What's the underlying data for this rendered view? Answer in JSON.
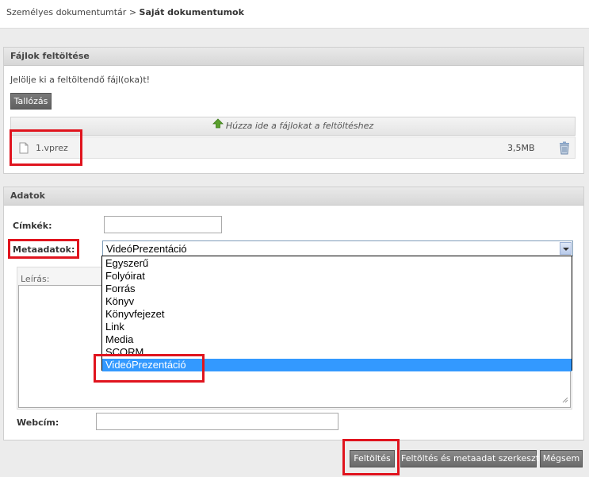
{
  "breadcrumb": {
    "parent": "Személyes dokumentumtár",
    "separator": ">",
    "current": "Saját dokumentumok"
  },
  "upload": {
    "header": "Fájlok feltöltése",
    "instruction": "Jelölje ki a feltöltendő fájl(oka)t!",
    "browse_label": "Tallózás",
    "dropzone_text": "Húzza ide a fájlokat a feltöltéshez",
    "file": {
      "name": "1.vprez",
      "size": "3,5MB"
    }
  },
  "data": {
    "header": "Adatok",
    "tags_label": "Címkék:",
    "tags_value": "",
    "metadata_label": "Metaadatok:",
    "metadata_selected": "VideóPrezentáció",
    "metadata_options": [
      "Egyszerű",
      "Folyóirat",
      "Forrás",
      "Könyv",
      "Könyvfejezet",
      "Link",
      "Media",
      "SCORM",
      "VideóPrezentáció"
    ],
    "description_label": "Leírás:",
    "url_label": "Webcím:",
    "url_value": ""
  },
  "actions": {
    "upload": "Feltöltés",
    "upload_and_edit": "Feltöltés és metaadat szerkesztés",
    "cancel": "Mégsem"
  }
}
